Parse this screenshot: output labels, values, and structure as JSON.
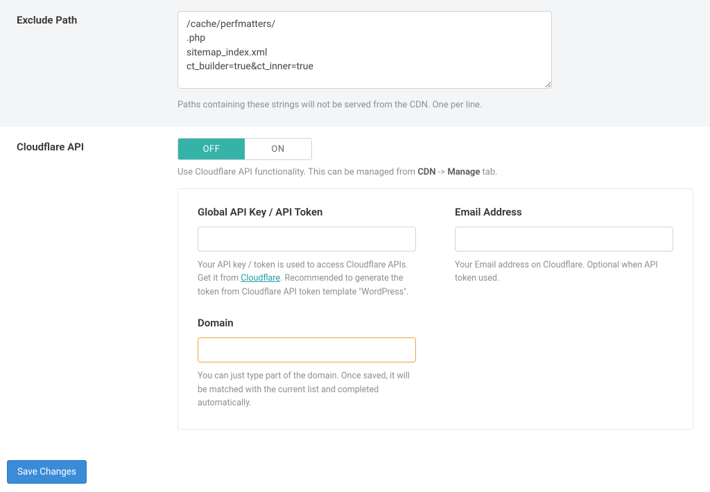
{
  "exclude_path": {
    "label": "Exclude Path",
    "value": "/cache/perfmatters/\n.php\nsitemap_index.xml\nct_builder=true&ct_inner=true",
    "help": "Paths containing these strings will not be served from the CDN. One per line."
  },
  "cloudflare": {
    "label": "Cloudflare API",
    "toggle": {
      "off": "OFF",
      "on": "ON",
      "value": "OFF"
    },
    "help_pre": "Use Cloudflare API functionality. This can be managed from ",
    "help_b1": "CDN",
    "help_arrow": " -> ",
    "help_b2": "Manage",
    "help_post": " tab.",
    "api_key": {
      "label": "Global API Key / API Token",
      "value": "",
      "help_pre": "Your API key / token is used to access Cloudflare APIs. Get it from ",
      "link_text": "Cloudflare",
      "help_post": ". Recommended to generate the token from Cloudflare API token template \"WordPress\"."
    },
    "email": {
      "label": "Email Address",
      "value": "",
      "help": "Your Email address on Cloudflare. Optional when API token used."
    },
    "domain": {
      "label": "Domain",
      "value": "",
      "help": "You can just type part of the domain. Once saved, it will be matched with the current list and completed automatically."
    }
  },
  "actions": {
    "save": "Save Changes"
  }
}
